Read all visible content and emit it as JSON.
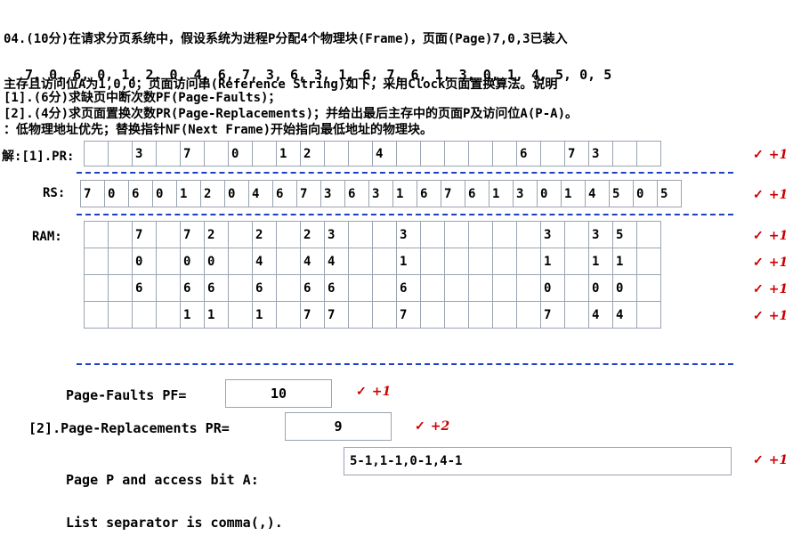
{
  "question": {
    "line1": "04.(10分)在请求分页系统中，假设系统为进程P分配4个物理块(Frame)，页面(Page)7,0,3已装入",
    "line2": "主存且访问位A为1,0,0；页面访问串(Reference String)如下，采用Clock页面置换算法。说明",
    "line3": "：低物理地址优先；替换指针NF(Next Frame)开始指向最低地址的物理块。"
  },
  "reference_string": "7, 0, 6, 0, 1, 2, 0, 4, 6, 7, 3, 6, 3, 1, 6, 7, 6, 1, 3, 0, 1, 4, 5, 0, 5",
  "subquestions": {
    "q1": "[1].(6分)求缺页中断次数PF(Page-Faults)；",
    "q2": "[2].(4分)求页面置换次数PR(Page-Replacements)；并给出最后主存中的页面P及访问位A(P-A)。"
  },
  "labels": {
    "pr": "解:[1].PR:",
    "rs": "RS:",
    "ram": "RAM:"
  },
  "pr_row": [
    "",
    "",
    "3",
    "",
    "7",
    "",
    "0",
    "",
    "1",
    "2",
    "",
    "",
    "4",
    "",
    "",
    "",
    "",
    "",
    "6",
    "",
    "7",
    "3",
    "",
    ""
  ],
  "rs_row": [
    "7",
    "0",
    "6",
    "0",
    "1",
    "2",
    "0",
    "4",
    "6",
    "7",
    "3",
    "6",
    "3",
    "1",
    "6",
    "7",
    "6",
    "1",
    "3",
    "0",
    "1",
    "4",
    "5",
    "0",
    "5"
  ],
  "ram_rows": [
    [
      "",
      "",
      "7",
      "",
      "7",
      "2",
      "",
      "2",
      "",
      "2",
      "3",
      "",
      "",
      "3",
      "",
      "",
      "",
      "",
      "",
      "3",
      "",
      "3",
      "5",
      ""
    ],
    [
      "",
      "",
      "0",
      "",
      "0",
      "0",
      "",
      "4",
      "",
      "4",
      "4",
      "",
      "",
      "1",
      "",
      "",
      "",
      "",
      "",
      "1",
      "",
      "1",
      "1",
      ""
    ],
    [
      "",
      "",
      "6",
      "",
      "6",
      "6",
      "",
      "6",
      "",
      "6",
      "6",
      "",
      "",
      "6",
      "",
      "",
      "",
      "",
      "",
      "0",
      "",
      "0",
      "0",
      ""
    ],
    [
      "",
      "",
      "",
      "",
      "1",
      "1",
      "",
      "1",
      "",
      "7",
      "7",
      "",
      "",
      "7",
      "",
      "",
      "",
      "",
      "",
      "7",
      "",
      "4",
      "4",
      ""
    ]
  ],
  "marks": {
    "check": "✓",
    "score1": "+1",
    "score2": "+2"
  },
  "answers": {
    "pf_label": "Page-Faults PF=",
    "pf_value": "10",
    "pr_label": "[2].Page-Replacements PR=",
    "pr_value": "9",
    "pa_label_1": "Page P and access bit A:",
    "pa_label_2": "List separator is comma(,).",
    "pa_value": "5-1,1-1,0-1,4-1"
  }
}
